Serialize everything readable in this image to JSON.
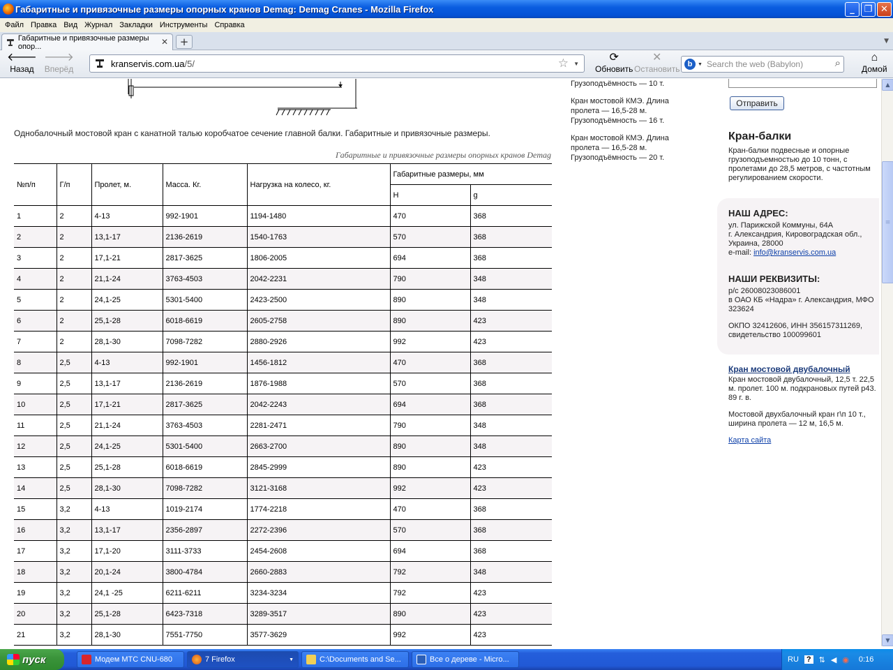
{
  "window": {
    "title": "Габаритные и привязочные размеры опорных кранов Demag: Demag Cranes - Mozilla Firefox"
  },
  "menu": [
    "Файл",
    "Правка",
    "Вид",
    "Журнал",
    "Закладки",
    "Инструменты",
    "Справка"
  ],
  "tab": {
    "title": "Габаритные и привязочные размеры опор..."
  },
  "nav": {
    "back": "Назад",
    "forward": "Вперёд",
    "url_host": "kranservis.com.ua",
    "url_path": "/5/",
    "reload": "Обновить",
    "stop": "Остановить",
    "search_placeholder": "Search the web (Babylon)",
    "home": "Домой"
  },
  "page": {
    "caption": "Однобалочный мостовой кран с канатной талью коробчатое сечение главной балки. Габаритные и привязочные размеры.",
    "table_title": "Габаритные и привязочные размеры опорных кранов Demag",
    "headers": {
      "num": "№п/п",
      "gp": "Г/п",
      "span": "Пролет, м.",
      "mass": "Масса. Кг.",
      "load": "Нагрузка на колесо, кг.",
      "dims": "Габаритные размеры, мм",
      "h": "H",
      "g": "g"
    },
    "rows": [
      [
        "1",
        "2",
        "4-13",
        "992-1901",
        "1194-1480",
        "470",
        "368"
      ],
      [
        "2",
        "2",
        "13,1-17",
        "2136-2619",
        "1540-1763",
        "570",
        "368"
      ],
      [
        "3",
        "2",
        "17,1-21",
        "2817-3625",
        "1806-2005",
        "694",
        "368"
      ],
      [
        "4",
        "2",
        "21,1-24",
        "3763-4503",
        "2042-2231",
        "790",
        "348"
      ],
      [
        "5",
        "2",
        "24,1-25",
        "5301-5400",
        "2423-2500",
        "890",
        "348"
      ],
      [
        "6",
        "2",
        "25,1-28",
        "6018-6619",
        "2605-2758",
        "890",
        "423"
      ],
      [
        "7",
        "2",
        "28,1-30",
        "7098-7282",
        "2880-2926",
        "992",
        "423"
      ],
      [
        "8",
        "2,5",
        "4-13",
        "992-1901",
        "1456-1812",
        "470",
        "368"
      ],
      [
        "9",
        "2,5",
        "13,1-17",
        "2136-2619",
        "1876-1988",
        "570",
        "368"
      ],
      [
        "10",
        "2,5",
        "17,1-21",
        "2817-3625",
        "2042-2243",
        "694",
        "368"
      ],
      [
        "11",
        "2,5",
        "21,1-24",
        "3763-4503",
        "2281-2471",
        "790",
        "348"
      ],
      [
        "12",
        "2,5",
        "24,1-25",
        "5301-5400",
        "2663-2700",
        "890",
        "348"
      ],
      [
        "13",
        "2,5",
        "25,1-28",
        "6018-6619",
        "2845-2999",
        "890",
        "423"
      ],
      [
        "14",
        "2,5",
        "28,1-30",
        "7098-7282",
        "3121-3168",
        "992",
        "423"
      ],
      [
        "15",
        "3,2",
        "4-13",
        "1019-2174",
        "1774-2218",
        "470",
        "368"
      ],
      [
        "16",
        "3,2",
        "13,1-17",
        "2356-2897",
        "2272-2396",
        "570",
        "368"
      ],
      [
        "17",
        "3,2",
        "17,1-20",
        "3111-3733",
        "2454-2608",
        "694",
        "368"
      ],
      [
        "18",
        "3,2",
        "20,1-24",
        "3800-4784",
        "2660-2883",
        "792",
        "348"
      ],
      [
        "19",
        "3,2",
        "24,1 -25",
        "6211-6211",
        "3234-3234",
        "792",
        "423"
      ],
      [
        "20",
        "3,2",
        "25,1-28",
        "6423-7318",
        "3289-3517",
        "890",
        "423"
      ],
      [
        "21",
        "3,2",
        "28,1-30",
        "7551-7750",
        "3577-3629",
        "992",
        "423"
      ]
    ]
  },
  "sidebar_left": {
    "items": [
      "Грузоподъёмность — 10 т.",
      "Кран мостовой КМЭ. Длина пролета — 16,5-28 м. Грузоподъёмность — 16 т.",
      "Кран мостовой КМЭ. Длина пролета — 16,5-28 м. Грузоподъёмность — 20 т."
    ]
  },
  "sidebar_right": {
    "send_button": "Отправить",
    "kb_title": "Кран-балки",
    "kb_text": "Кран-балки подвесные и опорные грузоподъемностью до 10 тонн, с пролетами до 28,5 метров, с частотным регулированием скорости.",
    "address_title": "НАШ АДРЕС:",
    "address_lines": [
      "ул. Парижской Коммуны, 64А",
      "г. Александрия, Кировоградская обл., Украина, 28000"
    ],
    "email_label": "e-mail: ",
    "email": "info@kranservis.com.ua",
    "requisites_title": "НАШИ РЕКВИЗИТЫ:",
    "requisites_lines": [
      "р/с 26008023086001",
      "в ОАО КБ «Надра» г. Александрия, МФО 323624",
      "ОКПО 32412606, ИНН 356157311269, свидетельство 100099601"
    ],
    "dbl_link": "Кран мостовой двубалочный",
    "dbl_text_1": "Кран мостовой двубалочный, 12,5 т. 22,5 м. пролет. 100 м. подкрановых путей р43. 89 г. в.",
    "dbl_text_2": "Мостовой двухбалочный кран г\\п 10 т., ширина пролета — 12 м, 16,5 м.",
    "sitemap": "Карта сайта"
  },
  "taskbar": {
    "start": "пуск",
    "tasks": [
      "Модем МТС CNU-680",
      "7 Firefox",
      "C:\\Documents and Se...",
      "Все о дереве - Micro..."
    ],
    "lang": "RU",
    "time": "0:16"
  }
}
